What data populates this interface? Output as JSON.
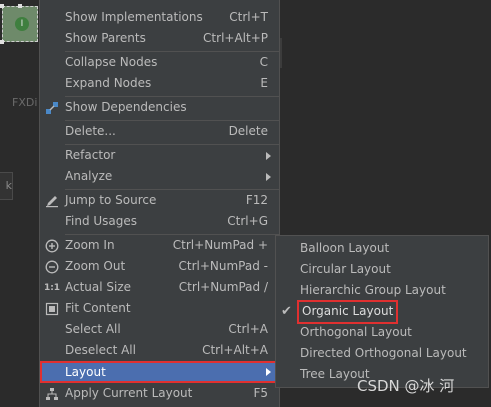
{
  "background": {
    "frag_fxdi": "FXDi",
    "frag_k": "k",
    "node_badge": "I"
  },
  "menu": {
    "items": [
      {
        "label": "Show Implementations",
        "shortcut": "Ctrl+T"
      },
      {
        "label": "Show Parents",
        "shortcut": "Ctrl+Alt+P"
      },
      {
        "label": "Collapse Nodes",
        "shortcut": "C"
      },
      {
        "label": "Expand Nodes",
        "shortcut": "E"
      },
      {
        "label": "Show Dependencies",
        "shortcut": "",
        "icon": "dependencies-icon"
      },
      {
        "label": "Delete...",
        "shortcut": "Delete"
      },
      {
        "label": "Refactor",
        "shortcut": "",
        "submenu": true
      },
      {
        "label": "Analyze",
        "shortcut": "",
        "submenu": true
      },
      {
        "label": "Jump to Source",
        "shortcut": "F12",
        "icon": "pencil-icon"
      },
      {
        "label": "Find Usages",
        "shortcut": "Ctrl+G"
      },
      {
        "label": "Zoom In",
        "shortcut": "Ctrl+NumPad +",
        "icon": "zoom-in-icon"
      },
      {
        "label": "Zoom Out",
        "shortcut": "Ctrl+NumPad -",
        "icon": "zoom-out-icon"
      },
      {
        "label": "Actual Size",
        "shortcut": "Ctrl+NumPad /",
        "icon": "actual-size-icon"
      },
      {
        "label": "Fit Content",
        "shortcut": "",
        "icon": "fit-content-icon"
      },
      {
        "label": "Select All",
        "shortcut": "Ctrl+A"
      },
      {
        "label": "Deselect All",
        "shortcut": "Ctrl+Alt+A"
      },
      {
        "label": "Layout",
        "shortcut": "",
        "submenu": true,
        "selected": true
      },
      {
        "label": "Apply Current Layout",
        "shortcut": "F5",
        "icon": "apply-layout-icon"
      }
    ]
  },
  "layout_submenu": {
    "items": [
      {
        "label": "Balloon Layout"
      },
      {
        "label": "Circular Layout"
      },
      {
        "label": "Hierarchic Group Layout"
      },
      {
        "label": "Organic Layout",
        "checked": true
      },
      {
        "label": "Orthogonal Layout"
      },
      {
        "label": "Directed Orthogonal Layout"
      },
      {
        "label": "Tree Layout"
      }
    ]
  },
  "watermark": "CSDN @冰 河",
  "colors": {
    "menu_bg": "#3c3f41",
    "selection": "#4b6eaf",
    "highlight_border": "#e03030",
    "text": "#bbbbbb",
    "separator": "#515151"
  }
}
